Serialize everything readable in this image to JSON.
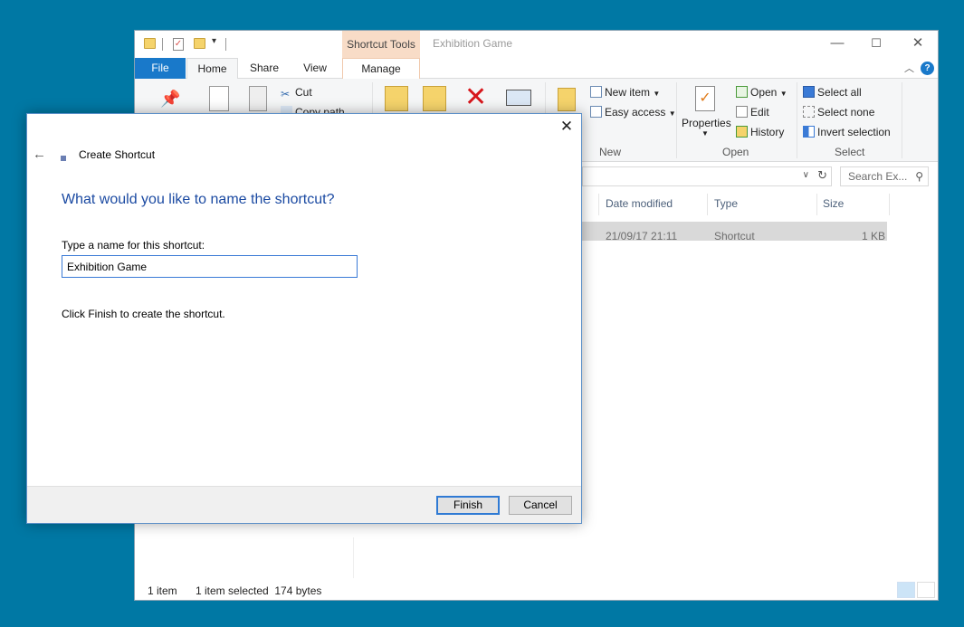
{
  "explorer": {
    "window_title": "Exhibition Game",
    "contextual_tab": "Shortcut Tools",
    "tabs": [
      "File",
      "Home",
      "Share",
      "View",
      "Manage"
    ],
    "ribbon": {
      "clipboard": {
        "cut": "Cut",
        "copy_path": "Copy path"
      },
      "new_group": {
        "new_item": "New item",
        "easy_access": "Easy access",
        "label": "New"
      },
      "open_group": {
        "properties": "Properties",
        "open": "Open",
        "edit": "Edit",
        "history": "History",
        "label": "Open"
      },
      "select_group": {
        "select_all": "Select all",
        "select_none": "Select none",
        "invert_selection": "Invert selection",
        "label": "Select"
      }
    },
    "search_placeholder": "Search Ex...",
    "columns": [
      "Date modified",
      "Type",
      "Size"
    ],
    "file_row": {
      "date_modified": "21/09/17 21:11",
      "type": "Shortcut",
      "size": "1 KB"
    },
    "status": {
      "item_count": "1 item",
      "selection": "1 item selected  174 bytes"
    }
  },
  "dialog": {
    "title": "Create Shortcut",
    "heading": "What would you like to name the shortcut?",
    "name_label": "Type a name for this shortcut:",
    "name_value": "Exhibition Game",
    "info": "Click Finish to create the shortcut.",
    "finish_button": "Finish",
    "cancel_button": "Cancel"
  },
  "colors": {
    "desktop": "#0078a4",
    "file_tab": "#1979ca",
    "contextual_tab": "#f8dcc7",
    "dialog_heading": "#1b4aa2"
  }
}
